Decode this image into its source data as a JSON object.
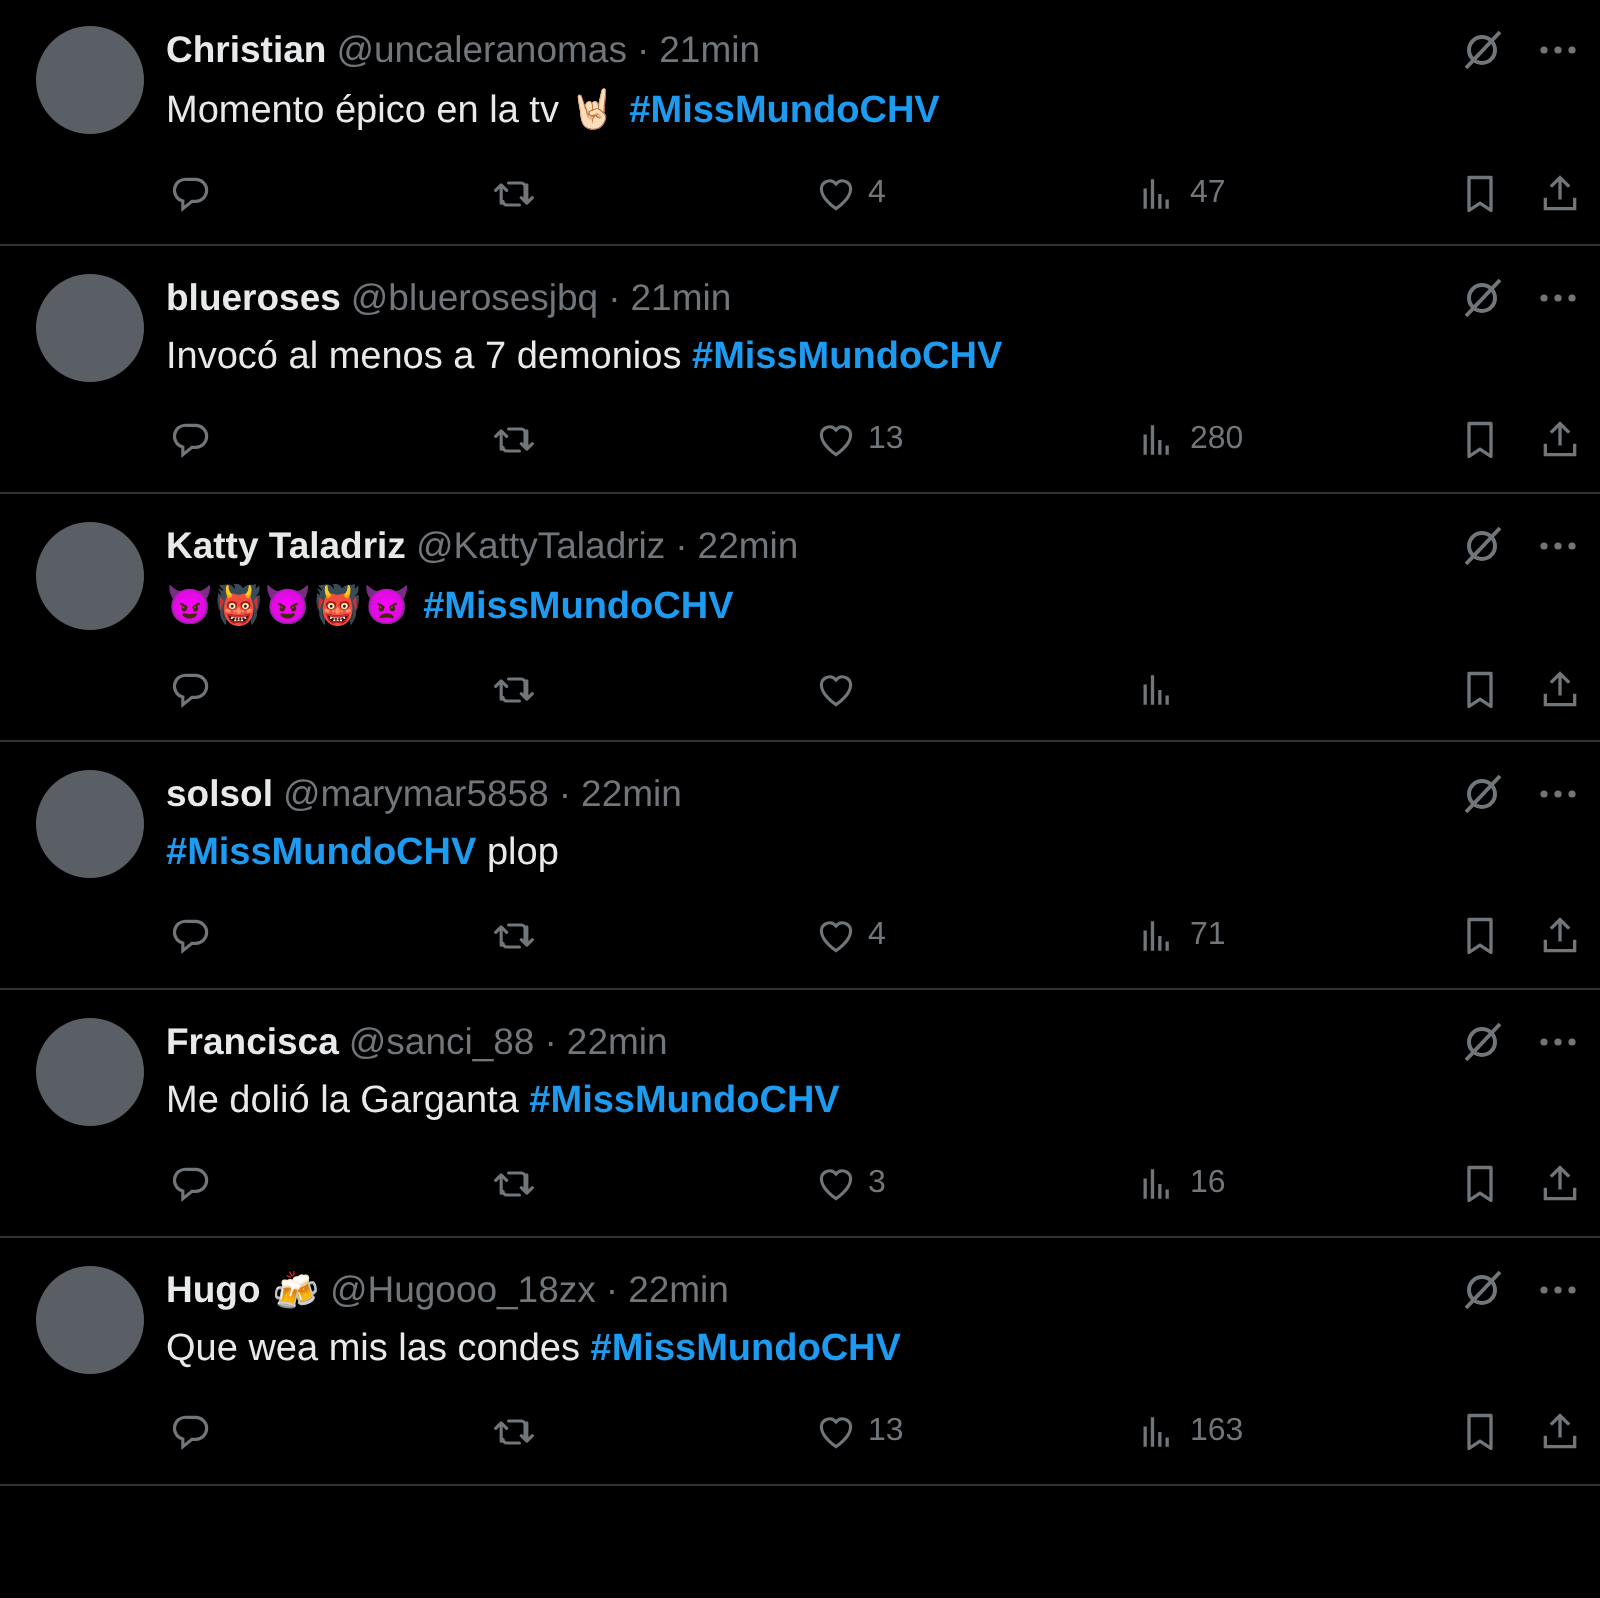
{
  "tweets": [
    {
      "name": "Christian",
      "handle": "@uncaleranomas",
      "separator": "·",
      "time": "21min",
      "body": [
        {
          "kind": "text",
          "text": "Momento épico en la tv"
        },
        {
          "kind": "emoji",
          "text": "🤘🏻"
        },
        {
          "kind": "hashtag",
          "text": "#MissMundoCHV"
        }
      ],
      "likes": "4",
      "views": "47"
    },
    {
      "name": "blueroses",
      "handle": "@bluerosesjbq",
      "separator": "·",
      "time": "21min",
      "body": [
        {
          "kind": "text",
          "text": "Invocó al menos a 7 demonios"
        },
        {
          "kind": "hashtag",
          "text": "#MissMundoCHV"
        }
      ],
      "likes": "13",
      "views": "280"
    },
    {
      "name": "Katty Taladriz",
      "handle": "@KattyTaladriz",
      "separator": "·",
      "time": "22min",
      "body": [
        {
          "kind": "emoji",
          "text": "😈👹😈👹👿"
        },
        {
          "kind": "hashtag",
          "text": "#MissMundoCHV"
        }
      ]
    },
    {
      "name": "solsol",
      "handle": "@marymar5858",
      "separator": "·",
      "time": "22min",
      "body": [
        {
          "kind": "hashtag",
          "text": "#MissMundoCHV"
        },
        {
          "kind": "text",
          "text": "plop"
        }
      ],
      "likes": "4",
      "views": "71"
    },
    {
      "name": "Francisca",
      "handle": "@sanci_88",
      "separator": "·",
      "time": "22min",
      "body": [
        {
          "kind": "text",
          "text": "Me dolió la Garganta"
        },
        {
          "kind": "hashtag",
          "text": "#MissMundoCHV"
        }
      ],
      "likes": "3",
      "views": "16"
    },
    {
      "name": "Hugo",
      "name_emoji": "🍻",
      "handle": "@Hugooo_18zx",
      "separator": "·",
      "time": "22min",
      "body": [
        {
          "kind": "text",
          "text": "Que wea mis las condes"
        },
        {
          "kind": "hashtag",
          "text": "#MissMundoCHV"
        }
      ],
      "likes": "13",
      "views": "163"
    }
  ]
}
